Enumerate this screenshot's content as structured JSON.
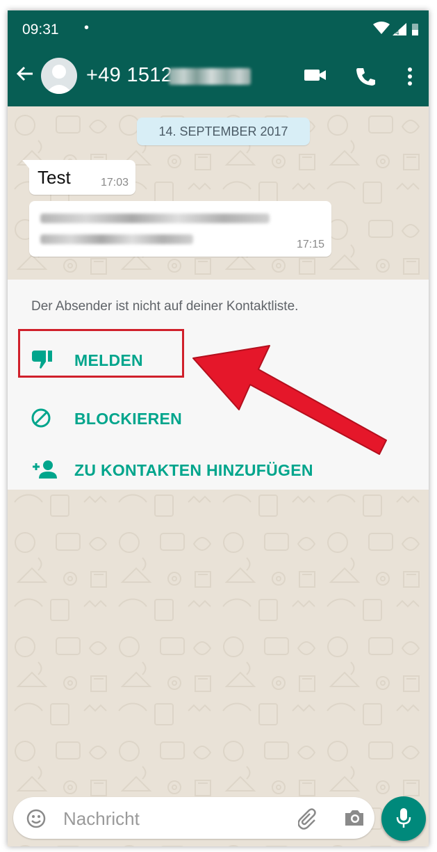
{
  "status_bar": {
    "time": "09:31",
    "dot": "•"
  },
  "app_bar": {
    "contact_number": "+49 1512"
  },
  "chat": {
    "date_chip": "14. SEPTEMBER 2017",
    "messages": [
      {
        "text": "Test",
        "time": "17:03"
      },
      {
        "text": "",
        "time": "17:15"
      }
    ]
  },
  "unknown_sender_panel": {
    "info": "Der Absender ist nicht auf deiner Kontaktliste.",
    "actions": [
      {
        "label": "MELDEN",
        "icon": "thumb-down-icon"
      },
      {
        "label": "BLOCKIEREN",
        "icon": "block-icon"
      },
      {
        "label": "ZU KONTAKTEN HINZUFÜGEN",
        "icon": "add-contact-icon"
      }
    ]
  },
  "input": {
    "placeholder": "Nachricht"
  },
  "colors": {
    "header": "#075e54",
    "accent": "#00a58c",
    "fab": "#00897b",
    "annotation": "#d0202b",
    "chat_background": "#e9e2d7"
  }
}
